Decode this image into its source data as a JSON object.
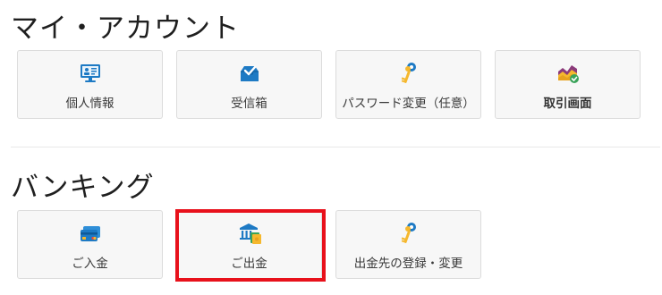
{
  "sections": [
    {
      "title": "マイ・アカウント",
      "items": [
        {
          "label": "個人情報",
          "icon": "monitor-profile-icon"
        },
        {
          "label": "受信箱",
          "icon": "inbox-tray-icon"
        },
        {
          "label": "パスワード変更（任意）",
          "icon": "keys-icon"
        },
        {
          "label": "取引画面",
          "icon": "trading-chart-icon"
        }
      ]
    },
    {
      "title": "バンキング",
      "items": [
        {
          "label": "ご入金",
          "icon": "credit-cards-icon"
        },
        {
          "label": "ご出金",
          "icon": "bank-withdraw-icon"
        },
        {
          "label": "出金先の登録・変更",
          "icon": "keys-icon"
        }
      ]
    }
  ],
  "colors": {
    "highlight": "#e8111b",
    "tile_bg": "#f7f7f7",
    "tile_border": "#dcdcdc",
    "icon_blue": "#1e7ac4",
    "icon_yellow": "#f5b82e",
    "icon_purple": "#8b3a7a",
    "icon_green": "#3aa35a"
  }
}
